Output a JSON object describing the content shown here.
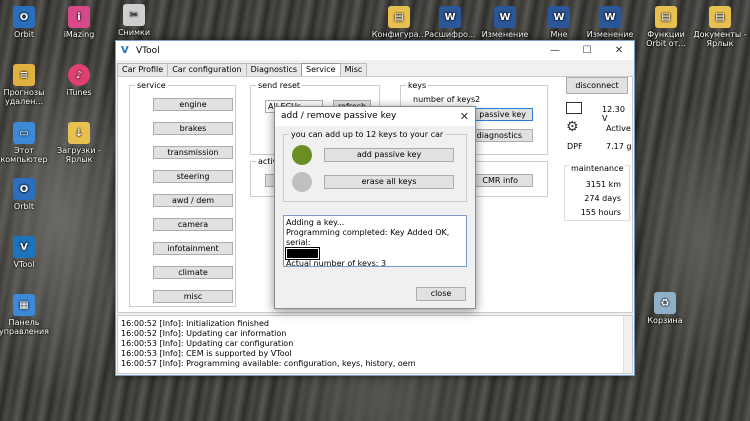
{
  "desktop": {
    "icons": [
      {
        "label": "Orbit",
        "color": "#2a6ebd",
        "glyph": "O"
      },
      {
        "label": "iMazing",
        "color": "#d64a8a",
        "glyph": "i"
      },
      {
        "label": "Снимки",
        "color": "#cfcfcf",
        "glyph": "✂"
      },
      {
        "label": "Прогнозы удален...",
        "color": "#e0b040",
        "glyph": "≡"
      },
      {
        "label": "iTunes",
        "color": "#e04070",
        "glyph": "♪"
      },
      {
        "label": "Этот компьютер",
        "color": "#3a8ad8",
        "glyph": "▭"
      },
      {
        "label": "Загрузки - Ярлык",
        "color": "#e8c050",
        "glyph": "↓"
      },
      {
        "label": "OrbIt",
        "color": "#2a6ebd",
        "glyph": "O"
      },
      {
        "label": "VTool",
        "color": "#1e73be",
        "glyph": "V"
      },
      {
        "label": "Панель управления",
        "color": "#3a8ad8",
        "glyph": "▦"
      },
      {
        "label": "Конфигура...",
        "color": "#e8c050",
        "glyph": "▤"
      },
      {
        "label": "Расшифро...",
        "color": "#2b579a",
        "glyph": "W"
      },
      {
        "label": "Изменение",
        "color": "#2b579a",
        "glyph": "W"
      },
      {
        "label": "Мне",
        "color": "#2b579a",
        "glyph": "W"
      },
      {
        "label": "Изменение",
        "color": "#2b579a",
        "glyph": "W"
      },
      {
        "label": "Функции Orbit от...",
        "color": "#e8c050",
        "glyph": "▤"
      },
      {
        "label": "Документы - Ярлык",
        "color": "#e8c050",
        "glyph": "▤"
      },
      {
        "label": "Корзина",
        "color": "#8fb0c8",
        "glyph": "♻"
      }
    ]
  },
  "window": {
    "title": "VTool",
    "controls": {
      "minimize": "—",
      "maximize": "☐",
      "close": "✕"
    }
  },
  "tabs": [
    "Car Profile",
    "Car configuration",
    "Diagnostics",
    "Service",
    "Misc"
  ],
  "active_tab": "Service",
  "service": {
    "group_label": "service",
    "buttons": [
      "engine",
      "brakes",
      "transmission",
      "steering",
      "awd / dem",
      "camera",
      "infotainment",
      "climate",
      "misc"
    ]
  },
  "send_reset": {
    "group_label": "send reset",
    "select_value": "All ECUs",
    "refresh_label": "refresh"
  },
  "active_group": {
    "label": "active c"
  },
  "keys": {
    "group_label": "keys",
    "number_label": "number of keys",
    "number_value": "2",
    "passive_key_button": "passive key",
    "diagnostics_button": "diagnostics",
    "cmr_button": "CMR info"
  },
  "right_panel": {
    "disconnect_label": "disconnect",
    "voltage": "12.30 V",
    "status": "Active",
    "dpf_label": "DPF",
    "dpf_value": "7.17 g",
    "maintenance_label": "maintenance",
    "km": "3151 km",
    "days": "274 days",
    "hours": "155 hours"
  },
  "log": [
    "16:00:52 [Info]: Initialization finished",
    "16:00:52 [Info]: Updating car information",
    "16:00:53 [Info]: Updating car configuration",
    "16:00:53 [Info]: CEM is supported by VTool",
    "16:00:57 [Info]: Programming available: configuration, keys, history, oem"
  ],
  "dialog": {
    "title": "add / remove passive key",
    "close_x": "✕",
    "group_label": "you can add up to 12 keys to your car",
    "add_button": "add passive key",
    "erase_button": "erase all keys",
    "status_colors": {
      "add": "#6b8e23",
      "erase": "#c0c0c0"
    },
    "log_line1": "Adding a key...",
    "log_line2": "Programming completed: Key Added OK, serial:",
    "log_line3": "Actual number of keys: 3",
    "close_button": "close"
  }
}
